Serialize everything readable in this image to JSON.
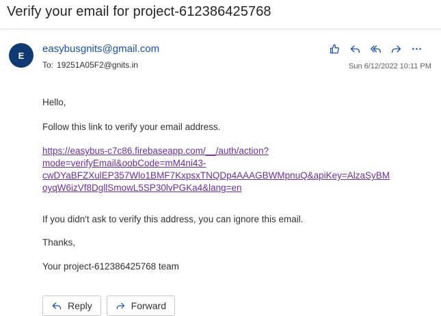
{
  "email": {
    "subject": "Verify your email for project-612386425768",
    "sender_initial": "E",
    "sender": "easybusgnits@gmail.com",
    "to_label": "To:",
    "to": "19251A05F2@gnits.in",
    "date": "Sun 6/12/2022 10:11 PM",
    "body": {
      "greeting": "Hello,",
      "instruction": "Follow this link to verify your email address.",
      "link_lines": [
        "https://easybus-c7c86.firebaseapp.com/__/auth/action?",
        "mode=verifyEmail&oobCode=mM4ni43-",
        "cwDYaBFZXulEP357Wlo1BMF7KxpsxTNQDp4AAAGBWMpnuQ&apiKey=AlzaSyBM",
        "oyqW6izVf8DgllSmowL5SP30lvPGKa4&lang=en"
      ],
      "ignore_note": "If you didn't ask to verify this address, you can ignore this email.",
      "thanks": "Thanks,",
      "signature": "Your project-612386425768 team"
    }
  },
  "actions": {
    "like_icon": "thumbs-up-icon",
    "reply_icon": "reply-icon",
    "reply_all_icon": "reply-all-icon",
    "forward_icon": "forward-icon",
    "more_icon": "more-icon"
  },
  "buttons": {
    "reply": "Reply",
    "forward": "Forward"
  },
  "colors": {
    "accent": "#1b4fa3",
    "avatar_bg": "#0f3a73",
    "link": "#6b2e9c"
  }
}
